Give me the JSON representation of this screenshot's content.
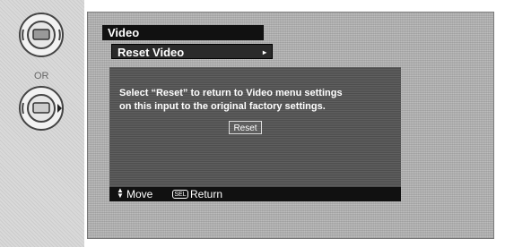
{
  "left_panel": {
    "or_label": "OR",
    "top_button_icon": "select-button-icon",
    "bottom_button_icon": "right-arrow-button-icon"
  },
  "menu": {
    "title": "Video",
    "item": "Reset Video",
    "item_arrow": "▸"
  },
  "dialog": {
    "line1": "Select “Reset” to return to Video menu settings",
    "line2": "on this input to the original factory settings.",
    "button_label": "Reset"
  },
  "statusbar": {
    "move_arrows": "▲▼",
    "move_label": "Move",
    "sel_key": "SEL",
    "return_label": "Return"
  }
}
